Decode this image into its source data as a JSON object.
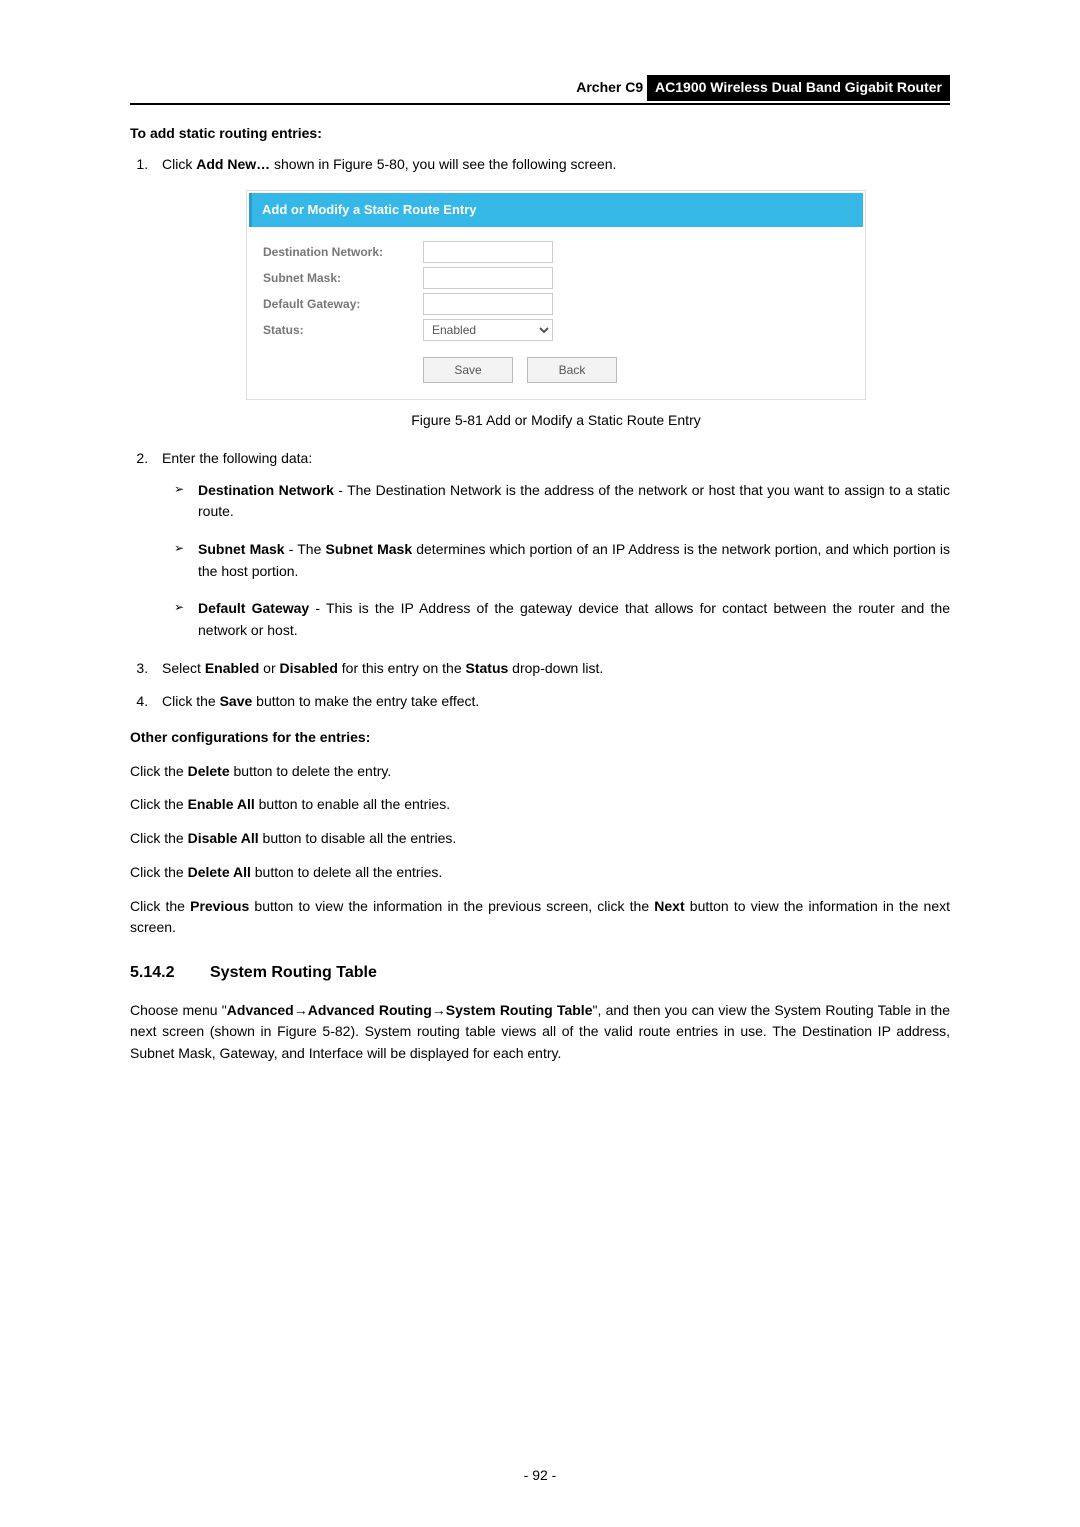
{
  "header": {
    "model": "Archer C9",
    "product": "AC1900 Wireless Dual Band Gigabit Router"
  },
  "section1_title": "To add static routing entries:",
  "step1": {
    "num": "1.",
    "text_pre": "Click ",
    "bold1": "Add New…",
    "text_post": " shown in Figure 5-80, you will see the following screen."
  },
  "figure": {
    "titlebar": "Add or Modify a Static Route Entry",
    "labels": {
      "dest": "Destination Network:",
      "mask": "Subnet Mask:",
      "gw": "Default Gateway:",
      "status": "Status:"
    },
    "status_value": "Enabled",
    "btn_save": "Save",
    "btn_back": "Back",
    "caption": "Figure 5-81 Add or Modify a Static Route Entry"
  },
  "step2": {
    "num": "2.",
    "intro": "Enter the following data:",
    "items": [
      {
        "b1": "Destination Network",
        "t1": " - The Destination Network is the address of the network or host that you want to assign to a static route."
      },
      {
        "b1": "Subnet Mask",
        "t1": " - The ",
        "b2": "Subnet Mask",
        "t2": " determines which portion of an IP Address is the network portion, and which portion is the host portion."
      },
      {
        "b1": "Default Gateway",
        "t1": " - This is the IP Address of the gateway device that allows for contact between the router and the network or host."
      }
    ]
  },
  "step3": {
    "num": "3.",
    "t1": "Select ",
    "b1": "Enabled",
    "t2": " or ",
    "b2": "Disabled",
    "t3": " for this entry on the ",
    "b3": "Status",
    "t4": " drop-down list."
  },
  "step4": {
    "num": "4.",
    "t1": "Click the ",
    "b1": "Save",
    "t2": " button to make the entry take effect."
  },
  "other_title": "Other configurations for the entries:",
  "other_paras": [
    {
      "t1": "Click the ",
      "b1": "Delete",
      "t2": " button to delete the entry."
    },
    {
      "t1": "Click the ",
      "b1": "Enable All",
      "t2": " button to enable all the entries."
    },
    {
      "t1": "Click the ",
      "b1": "Disable All",
      "t2": " button to disable all the entries."
    },
    {
      "t1": "Click the ",
      "b1": "Delete All",
      "t2": " button to delete all the entries."
    }
  ],
  "prev_next": {
    "t1": "Click the ",
    "b1": "Previous",
    "t2": " button to view the information in the previous screen, click the ",
    "b2": "Next",
    "t3": " button to view the information in the next screen."
  },
  "h3": {
    "num": "5.14.2",
    "title": "System Routing Table"
  },
  "h3_para": {
    "t1": "Choose menu \"",
    "b1": "Advanced",
    "arrow1": "→",
    "b2": "Advanced Routing",
    "arrow2": "→",
    "b3": "System Routing Table",
    "t2": "\", and then you can view the System Routing Table in the next screen (shown in Figure 5-82). System routing table views all of the valid route entries in use. The Destination IP address, Subnet Mask, Gateway, and Interface will be displayed for each entry."
  },
  "page_number": "- 92 -"
}
